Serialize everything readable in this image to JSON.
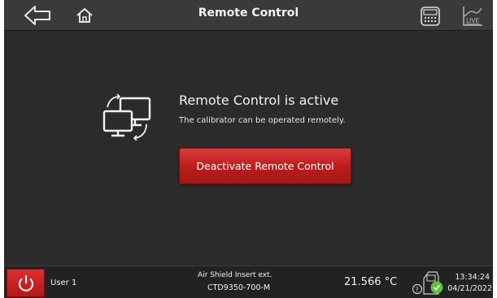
{
  "header": {
    "title": "Remote Control",
    "icons": {
      "back": "back-arrow-icon",
      "home": "home-icon",
      "keyboard": "keyboard-icon",
      "live": "live-chart-icon"
    },
    "live_label": "LIVE"
  },
  "main": {
    "heading": "Remote Control is active",
    "subtext": "The calibrator can be operated remotely.",
    "deactivate_label": "Deactivate Remote Control",
    "icon": "remote-computers-icon",
    "button_color": "#c62828"
  },
  "status_bar": {
    "power_icon": "power-icon",
    "user": "User 1",
    "sensor_name": "Air Shield Insert ext.",
    "sensor_model": "CTD9350-700-M",
    "temperature": "21.566 °C",
    "device_status_icon": "calibrator-status-icon",
    "status_color": "#5ec43a",
    "time": "13:34:24",
    "date": "04/21/2022"
  }
}
